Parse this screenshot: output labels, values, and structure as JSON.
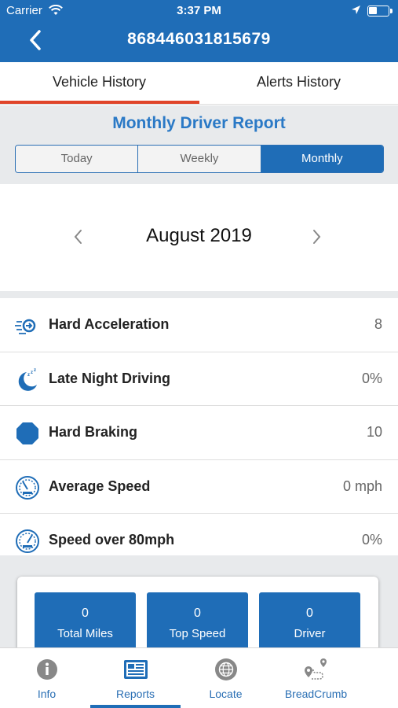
{
  "status_bar": {
    "carrier": "Carrier",
    "time": "3:37 PM",
    "icons": [
      "wifi-icon",
      "location-arrow-icon",
      "battery-icon"
    ]
  },
  "nav": {
    "title": "868446031815679",
    "back_icon": "chevron-left-icon"
  },
  "tabs": [
    {
      "label": "Vehicle History",
      "selected": true
    },
    {
      "label": "Alerts History",
      "selected": false
    }
  ],
  "report": {
    "title": "Monthly Driver Report",
    "periods": [
      {
        "label": "Today",
        "selected": false
      },
      {
        "label": "Weekly",
        "selected": false
      },
      {
        "label": "Monthly",
        "selected": true
      }
    ]
  },
  "month_picker": {
    "label": "August 2019",
    "prev_icon": "chevron-left-icon",
    "next_icon": "chevron-right-icon"
  },
  "metrics": [
    {
      "label": "Hard Acceleration",
      "value": "8",
      "icon": "acceleration-icon"
    },
    {
      "label": "Late Night Driving",
      "value": "0%",
      "icon": "moon-sleep-icon"
    },
    {
      "label": "Hard Braking",
      "value": "10",
      "icon": "octagon-stop-icon"
    },
    {
      "label": "Average Speed",
      "value": "0 mph",
      "icon": "speedometer-icon"
    },
    {
      "label": "Speed over 80mph",
      "value": "0%",
      "icon": "speedometer-icon"
    }
  ],
  "summary": [
    {
      "value": "0",
      "label": "Total Miles"
    },
    {
      "value": "0",
      "label": "Top Speed"
    },
    {
      "value": "0",
      "label": "Driver"
    }
  ],
  "tabbar": [
    {
      "label": "Info",
      "icon": "info-icon",
      "selected": false
    },
    {
      "label": "Reports",
      "icon": "report-icon",
      "selected": true
    },
    {
      "label": "Locate",
      "icon": "globe-icon",
      "selected": false
    },
    {
      "label": "BreadCrumb",
      "icon": "breadcrumb-route-icon",
      "selected": false
    }
  ],
  "colors": {
    "brand_blue": "#1f6db7",
    "title_blue": "#2a79c6",
    "tab_underline": "#e0452a",
    "section_gray": "#e8eaec"
  }
}
